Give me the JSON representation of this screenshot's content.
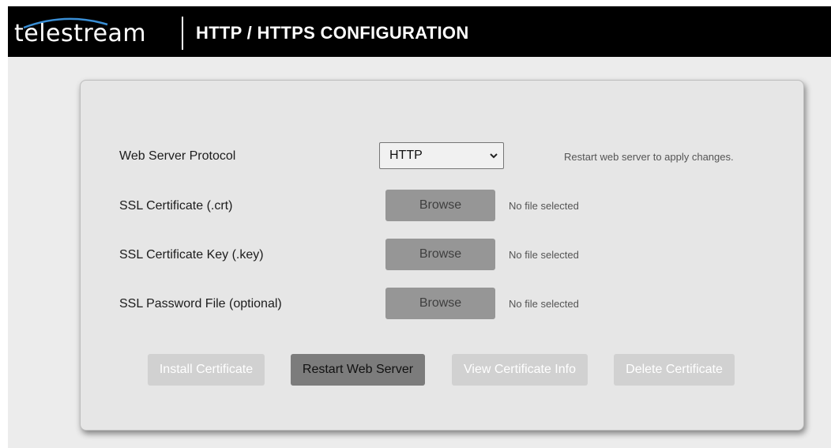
{
  "header": {
    "logo_text": "telestream",
    "title": "HTTP / HTTPS CONFIGURATION"
  },
  "form": {
    "protocol": {
      "label": "Web Server Protocol",
      "selected": "HTTP",
      "hint": "Restart web server to apply changes."
    },
    "files": [
      {
        "label": "SSL Certificate (.crt)",
        "button": "Browse",
        "status": "No file selected"
      },
      {
        "label": "SSL Certificate Key (.key)",
        "button": "Browse",
        "status": "No file selected"
      },
      {
        "label": "SSL Password File (optional)",
        "button": "Browse",
        "status": "No file selected"
      }
    ]
  },
  "actions": {
    "install": "Install Certificate",
    "restart": "Restart Web Server",
    "view": "View Certificate Info",
    "delete": "Delete Certificate"
  },
  "colors": {
    "header_bg": "#000000",
    "panel_bg": "#e6e6e6",
    "browse_bg": "#969696",
    "active_button_bg": "#7c7c7c",
    "disabled_button_bg": "#d1d1d1"
  }
}
